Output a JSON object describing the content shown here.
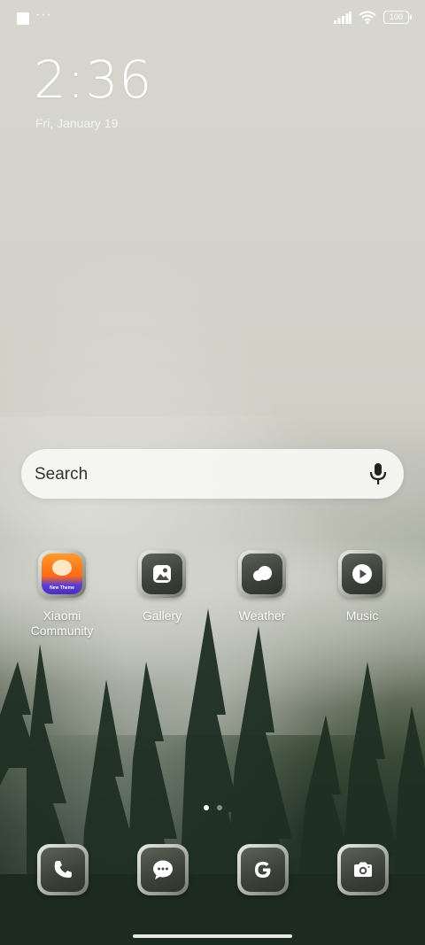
{
  "status_bar": {
    "dots": "···",
    "battery": "100"
  },
  "lockscreen": {
    "time": "2:36",
    "date": "Fri, January 19"
  },
  "search": {
    "placeholder": "Search"
  },
  "apps": [
    {
      "label": "Xiaomi Community",
      "icon": "xiaomi-community-icon",
      "badge_text": "New Theme"
    },
    {
      "label": "Gallery",
      "icon": "gallery-icon"
    },
    {
      "label": "Weather",
      "icon": "weather-icon"
    },
    {
      "label": "Music",
      "icon": "music-icon"
    }
  ],
  "dock": [
    {
      "icon": "phone-icon"
    },
    {
      "icon": "messages-icon"
    },
    {
      "icon": "google-icon"
    },
    {
      "icon": "camera-icon"
    }
  ],
  "pages": {
    "count": 2,
    "active": 1
  }
}
